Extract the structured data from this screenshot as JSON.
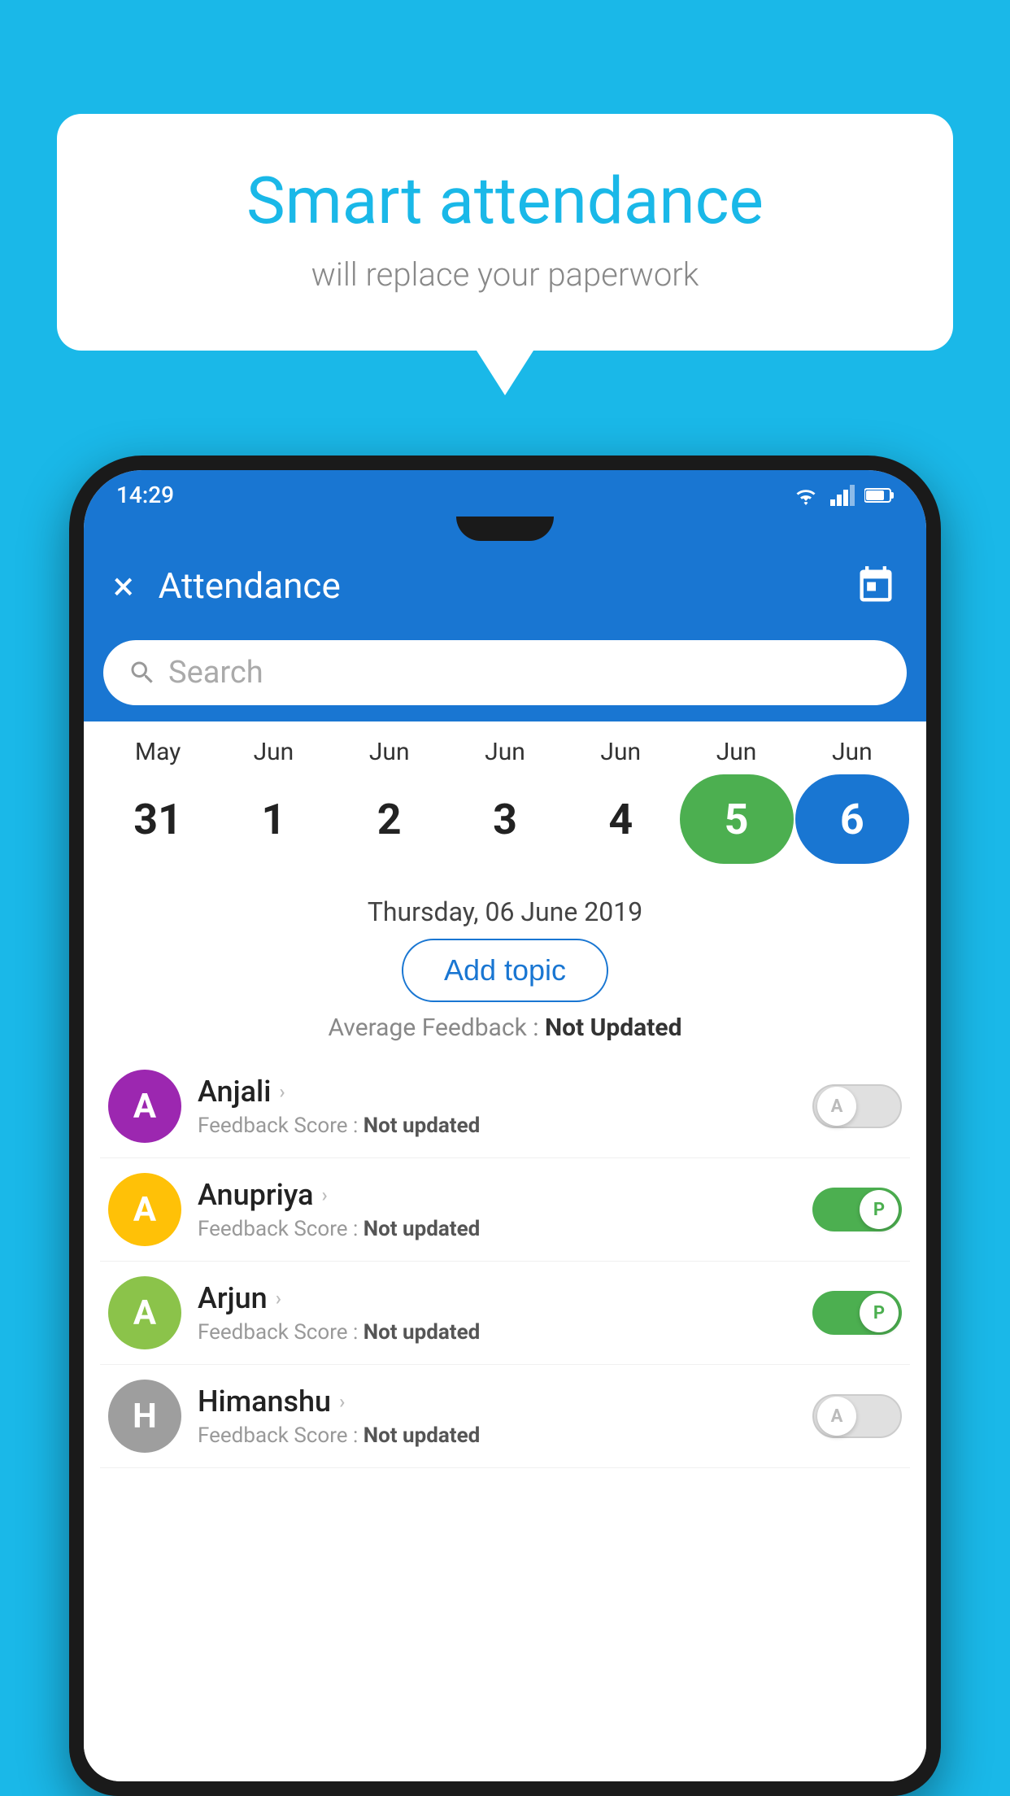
{
  "background_color": "#1ab8e8",
  "speech_bubble": {
    "title": "Smart attendance",
    "subtitle": "will replace your paperwork"
  },
  "status_bar": {
    "time": "14:29",
    "wifi_icon": "wifi",
    "signal_icon": "signal",
    "battery_icon": "battery"
  },
  "app_bar": {
    "close_label": "×",
    "title": "Attendance",
    "calendar_icon": "calendar"
  },
  "search": {
    "placeholder": "Search"
  },
  "calendar": {
    "months": [
      "May",
      "Jun",
      "Jun",
      "Jun",
      "Jun",
      "Jun",
      "Jun"
    ],
    "days": [
      "31",
      "1",
      "2",
      "3",
      "4",
      "5",
      "6"
    ],
    "today_index": 4,
    "selected_index": 5,
    "selected_label": "Thursday, 06 June 2019"
  },
  "add_topic": {
    "label": "Add topic"
  },
  "average_feedback": {
    "label": "Average Feedback : ",
    "value": "Not Updated"
  },
  "students": [
    {
      "name": "Anjali",
      "initial": "A",
      "avatar_color": "#9c27b0",
      "feedback_label": "Feedback Score : ",
      "feedback_value": "Not updated",
      "attendance": "absent",
      "toggle_label": "A"
    },
    {
      "name": "Anupriya",
      "initial": "A",
      "avatar_color": "#ffc107",
      "feedback_label": "Feedback Score : ",
      "feedback_value": "Not updated",
      "attendance": "present",
      "toggle_label": "P"
    },
    {
      "name": "Arjun",
      "initial": "A",
      "avatar_color": "#8bc34a",
      "feedback_label": "Feedback Score : ",
      "feedback_value": "Not updated",
      "attendance": "present",
      "toggle_label": "P"
    },
    {
      "name": "Himanshu",
      "initial": "H",
      "avatar_color": "#9e9e9e",
      "feedback_label": "Feedback Score : ",
      "feedback_value": "Not updated",
      "attendance": "absent",
      "toggle_label": "A"
    }
  ]
}
